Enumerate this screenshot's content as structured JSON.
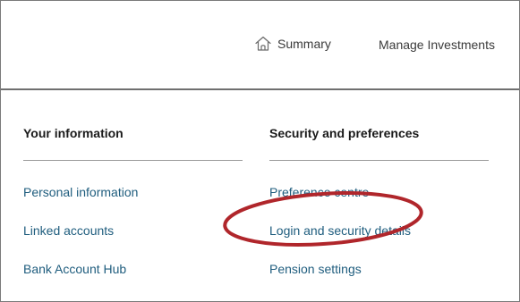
{
  "nav": {
    "summary_label": "Summary",
    "summary_icon": "home-icon",
    "manage_investments_label": "Manage Investments"
  },
  "sections": {
    "your_information": {
      "heading": "Your information",
      "links": [
        "Personal information",
        "Linked accounts",
        "Bank Account Hub"
      ]
    },
    "security_and_preferences": {
      "heading": "Security and preferences",
      "links": [
        "Preference centre",
        "Login and security details",
        "Pension settings"
      ]
    }
  },
  "colors": {
    "link": "#1f5d7e",
    "heading": "#1a1a1a",
    "annotation_circle": "#b0262b"
  }
}
